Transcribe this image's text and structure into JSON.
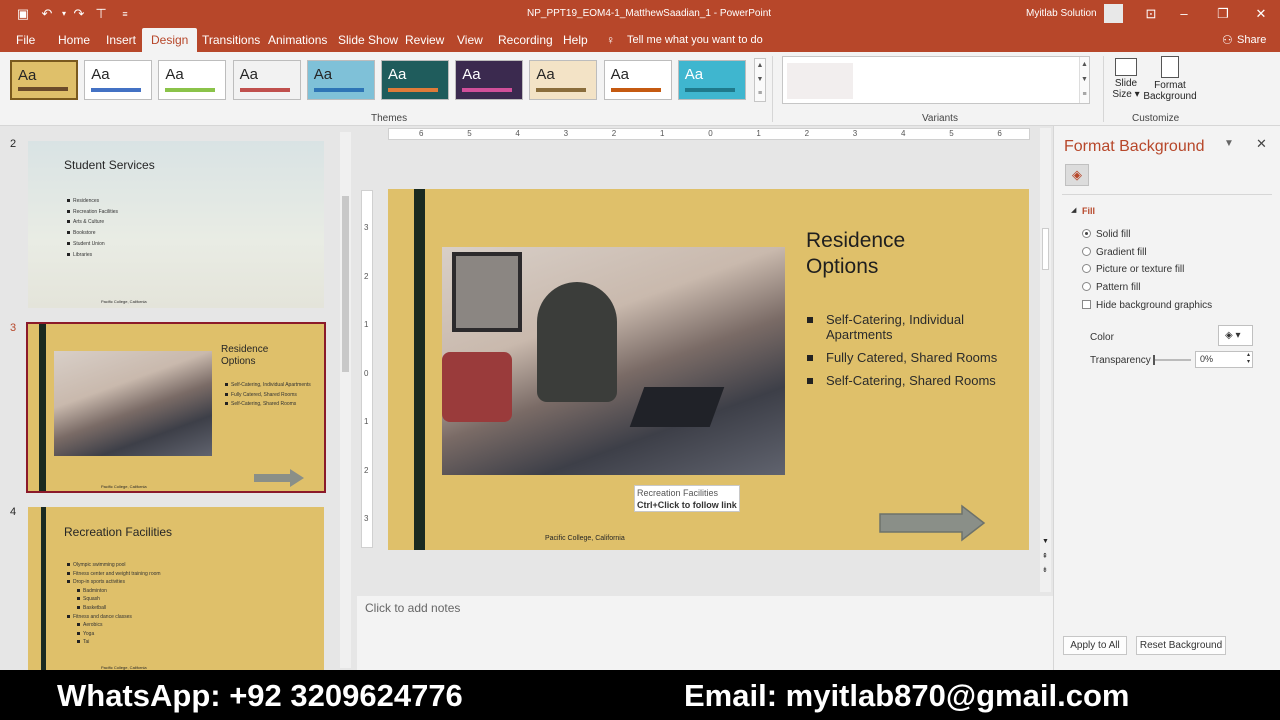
{
  "titlebar": {
    "filename": "NP_PPT19_EOM4-1_MatthewSaadian_1",
    "separator": "-",
    "app": "PowerPoint",
    "user": "Myitlab Solution"
  },
  "tabs": [
    {
      "label": "File"
    },
    {
      "label": "Home"
    },
    {
      "label": "Insert"
    },
    {
      "label": "Design"
    },
    {
      "label": "Transitions"
    },
    {
      "label": "Animations"
    },
    {
      "label": "Slide Show"
    },
    {
      "label": "Review"
    },
    {
      "label": "View"
    },
    {
      "label": "Recording"
    },
    {
      "label": "Help"
    }
  ],
  "tell_me": "Tell me what you want to do",
  "share": "Share",
  "ribbon": {
    "themes_label": "Themes",
    "variants_label": "Variants",
    "customize_label": "Customize",
    "theme_text": "Aa",
    "slide_size_l1": "Slide",
    "slide_size_l2": "Size",
    "format_bg_l1": "Format",
    "format_bg_l2": "Background"
  },
  "themes": [
    {
      "bg": "#dfc06a",
      "bar": "#6b4b2a"
    },
    {
      "bg": "#ffffff",
      "bar": "#4472c4"
    },
    {
      "bg": "#ffffff",
      "bar": "#8bc34a"
    },
    {
      "bg": "#f2f2f2",
      "bar": "#c0504d"
    },
    {
      "bg": "#7fc1d8",
      "bar": "#2e75b6"
    },
    {
      "bg": "#1f5c5c",
      "bar": "#e07b39"
    },
    {
      "bg": "#3b2a4f",
      "bar": "#d14f9a"
    },
    {
      "bg": "#f3e3c6",
      "bar": "#8a6d3b"
    },
    {
      "bg": "#ffffff",
      "bar": "#c55a11"
    },
    {
      "bg": "#3fb6cf",
      "bar": "#1f7a8c"
    }
  ],
  "thumbnails": {
    "s2": {
      "num": "2",
      "title": "Student Services",
      "bullets": [
        "Residences",
        "Recreation Facilities",
        "Arts & Culture",
        "Bookstore",
        "Student Union",
        "Libraries"
      ],
      "footer": "Pacific College, California"
    },
    "s3": {
      "num": "3",
      "title_l1": "Residence",
      "title_l2": "Options",
      "bullets": [
        "Self-Catering, Individual Apartments",
        "Fully Catered, Shared Rooms",
        "Self-Catering, Shared Rooms"
      ],
      "footer": "Pacific College, California"
    },
    "s4": {
      "num": "4",
      "title": "Recreation Facilities",
      "bullets": [
        "Olympic swimming pool",
        "Fitness center and weight training room",
        "Drop-in sports activities",
        "Badminton",
        "Squash",
        "Basketball",
        "Fitness and dance classes",
        "Aerobics",
        "Yoga",
        "Tai"
      ],
      "footer": "Pacific College, California"
    }
  },
  "slide": {
    "title_l1": "Residence",
    "title_l2": "Options",
    "bullets": [
      "Self-Catering, Individual Apartments",
      "Fully Catered, Shared Rooms",
      "Self-Catering, Shared Rooms"
    ],
    "footer": "Pacific College, California",
    "tooltip_l1": "Recreation Facilities",
    "tooltip_l2": "Ctrl+Click to follow link"
  },
  "ruler_h": [
    "6",
    "5",
    "4",
    "3",
    "2",
    "1",
    "0",
    "1",
    "2",
    "3",
    "4",
    "5",
    "6"
  ],
  "ruler_v": [
    "3",
    "2",
    "1",
    "0",
    "1",
    "2",
    "3"
  ],
  "notes_placeholder": "Click to add notes",
  "format_panel": {
    "title": "Format Background",
    "fill_header": "Fill",
    "options": [
      "Solid fill",
      "Gradient fill",
      "Picture or texture fill",
      "Pattern fill"
    ],
    "selected": "Solid fill",
    "hide_bg": "Hide background graphics",
    "color_label": "Color",
    "transparency_label": "Transparency",
    "transparency_value": "0%",
    "apply_all": "Apply to All",
    "reset": "Reset Background"
  },
  "footer": {
    "whatsapp": "WhatsApp: +92 3209624776",
    "email": "Email: myitlab870@gmail.com"
  },
  "colors": {
    "accent": "#b7472a",
    "slide_bg": "#dfc06a",
    "slide_stripe": "#1a2a20",
    "arrow": "#8a8f88"
  }
}
